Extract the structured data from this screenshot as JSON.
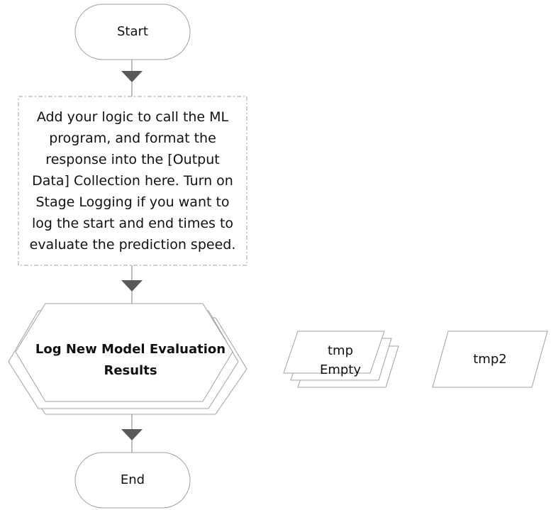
{
  "colors": {
    "shape_stroke": "#a0a0a0",
    "connector": "#8b7b6b",
    "arrow_fill": "#595959",
    "text": "#111111",
    "background": "#ffffff"
  },
  "nodes": {
    "start": {
      "label": "Start"
    },
    "note": {
      "text": "Add your logic to call the ML\nprogram, and format the\nresponse into the [Output\nData] Collection here. Turn on\nStage Logging if you want to\nlog the start and end times to\nevaluate the prediction speed."
    },
    "log_process": {
      "label": "Log New Model Evaluation\nResults"
    },
    "collection_tmp": {
      "label": "tmp\nEmpty"
    },
    "data_tmp2": {
      "label": "tmp2"
    },
    "end": {
      "label": "End"
    }
  }
}
